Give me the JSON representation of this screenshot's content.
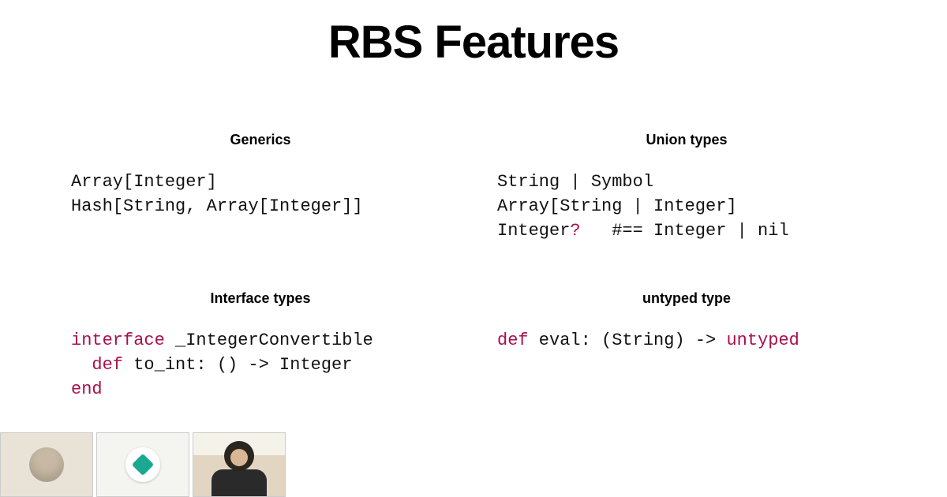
{
  "title": "RBS Features",
  "sections": {
    "generics": {
      "heading": "Generics",
      "line1_a": "Array[Integer]",
      "line2_a": "Hash[String, Array[Integer]]"
    },
    "union": {
      "heading": "Union types",
      "line1": "String | Symbol",
      "line2": "Array[String | Integer]",
      "line3_a": "Integer",
      "line3_q": "?",
      "line3_b": "   #== Integer | nil"
    },
    "interface": {
      "heading": "Interface types",
      "kw_interface": "interface",
      "name": " _IntegerConvertible",
      "kw_def": "def",
      "sig": " to_int: () -> Integer",
      "kw_end": "end"
    },
    "untyped": {
      "heading": "untyped type",
      "kw_def": "def",
      "sig_a": " eval: (String) -> ",
      "kw_untyped": "untyped"
    }
  },
  "thumbnails": [
    {
      "name": "participant-1"
    },
    {
      "name": "participant-2-ruby"
    },
    {
      "name": "participant-3-speaker"
    }
  ]
}
